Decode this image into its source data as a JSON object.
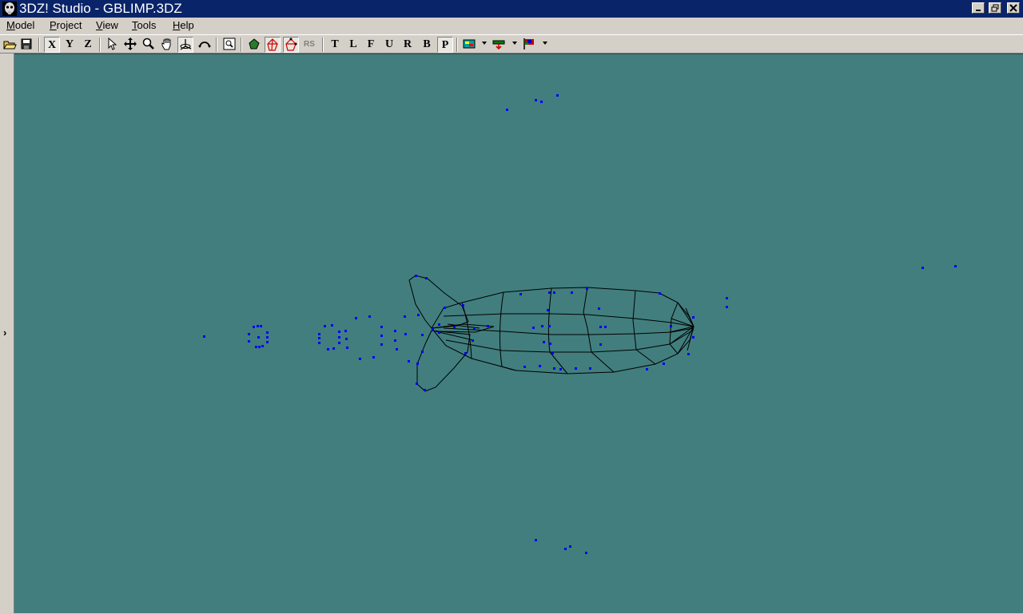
{
  "window": {
    "title": "3DZ! Studio - GBLIMP.3DZ",
    "controls": [
      "minimize",
      "restore",
      "close"
    ]
  },
  "menu": {
    "items": [
      {
        "label": "Model"
      },
      {
        "label": "Project"
      },
      {
        "label": "View"
      },
      {
        "label": "Tools"
      },
      {
        "label": "Help"
      }
    ]
  },
  "toolbar": {
    "axis_x": "X",
    "axis_y": "Y",
    "axis_z": "Z",
    "rs_label": "RS",
    "view_t": "T",
    "view_l": "L",
    "view_f": "F",
    "view_u": "U",
    "view_r": "R",
    "view_b": "B",
    "view_p": "P"
  },
  "sidebar": {
    "toggle_glyph": "›"
  },
  "colors": {
    "titlebar": "#0a246a",
    "viewport_bg": "#427e7e",
    "vertex": "#0000ff",
    "wireframe": "#000000"
  }
}
